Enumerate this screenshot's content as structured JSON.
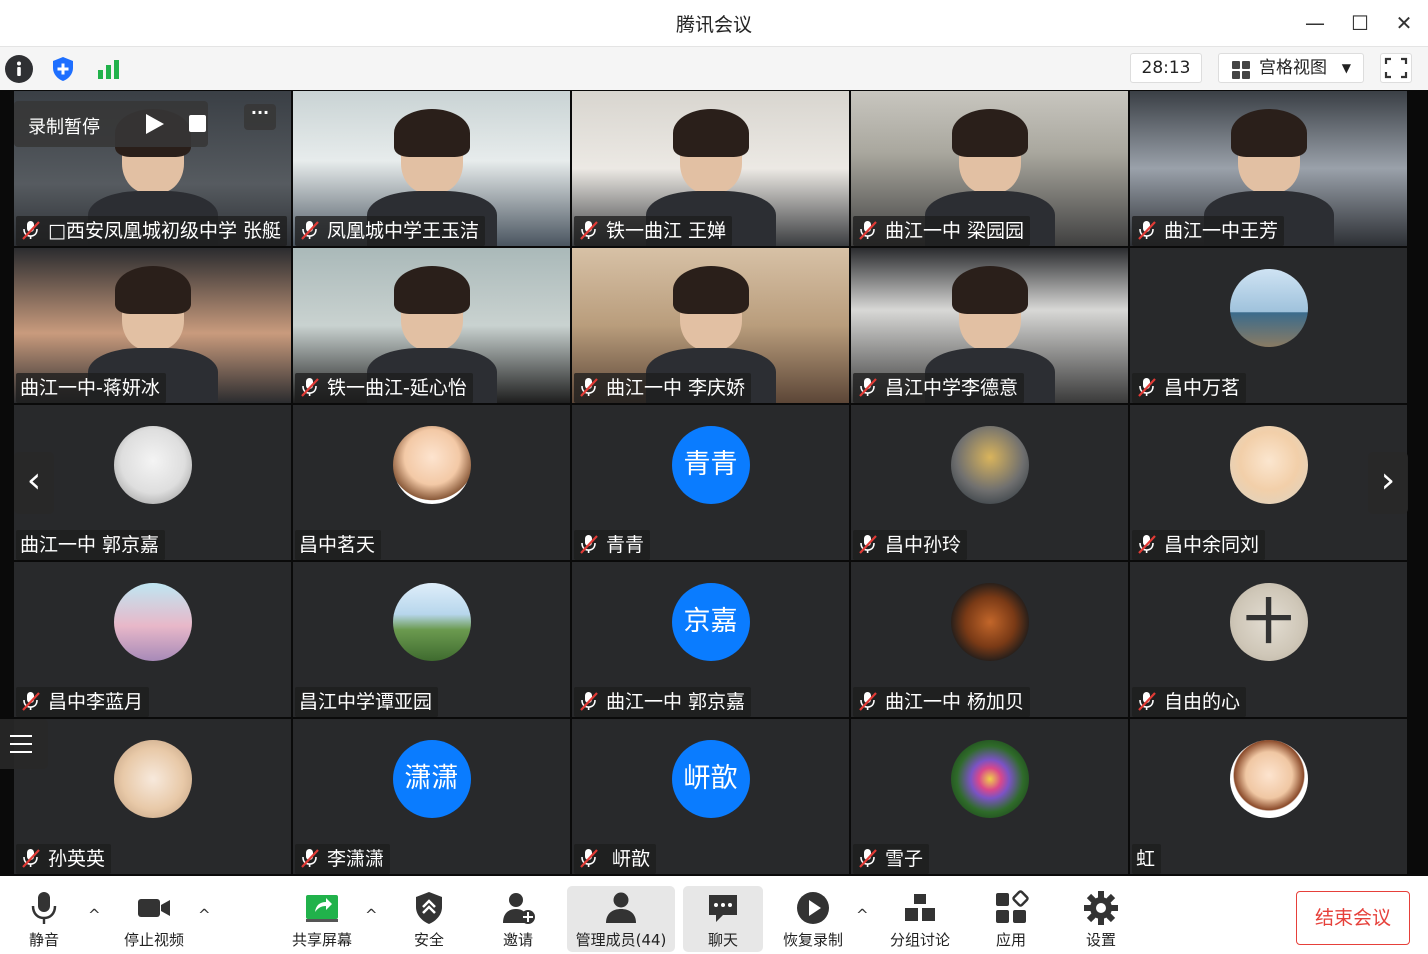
{
  "window": {
    "title": "腾讯会议",
    "minimize": "—",
    "maximize": "☐",
    "close": "✕"
  },
  "top_bar": {
    "timer": "28:13",
    "view_label": "宫格视图",
    "view_caret": "▼"
  },
  "recording": {
    "label": "录制暂停",
    "more": "···"
  },
  "nav": {
    "prev": "‹",
    "next": "›"
  },
  "participants": [
    {
      "name": "□西安凤凰城初级中学 张艇",
      "muted": true,
      "type": "video"
    },
    {
      "name": "凤凰城中学王玉洁",
      "muted": true,
      "type": "video"
    },
    {
      "name": "铁一曲江 王婵",
      "muted": true,
      "type": "video"
    },
    {
      "name": "曲江一中 梁园园",
      "muted": true,
      "type": "video"
    },
    {
      "name": "曲江一中王芳",
      "muted": true,
      "type": "video"
    },
    {
      "name": "曲江一中-蒋妍冰",
      "muted": false,
      "type": "video"
    },
    {
      "name": "铁一曲江-延心怡",
      "muted": true,
      "type": "video"
    },
    {
      "name": "曲江一中 李庆娇",
      "muted": true,
      "type": "video"
    },
    {
      "name": "昌江中学李德意",
      "muted": true,
      "type": "video"
    },
    {
      "name": "昌中万茗",
      "muted": true,
      "type": "avatar",
      "icon": "seaside-photo-avatar-icon"
    },
    {
      "name": "曲江一中 郭京嘉",
      "muted": false,
      "type": "avatar",
      "icon": "snow-bear-avatar-icon"
    },
    {
      "name": "昌中茗天",
      "muted": false,
      "type": "avatar",
      "icon": "cartoon-girl-avatar-icon"
    },
    {
      "name": "青青",
      "muted": true,
      "type": "text",
      "avatar_text": "青青"
    },
    {
      "name": "昌中孙玲",
      "muted": true,
      "type": "avatar",
      "icon": "umbrella-avatar-icon"
    },
    {
      "name": "昌中余同刘",
      "muted": true,
      "type": "avatar",
      "icon": "baby-avatar-icon"
    },
    {
      "name": "昌中李蓝月",
      "muted": true,
      "type": "avatar",
      "icon": "anime-girl-avatar-icon"
    },
    {
      "name": "昌江中学谭亚园",
      "muted": false,
      "type": "avatar",
      "icon": "wedding-avatar-icon"
    },
    {
      "name": "曲江一中 郭京嘉",
      "muted": true,
      "type": "text",
      "avatar_text": "京嘉"
    },
    {
      "name": "曲江一中 杨加贝",
      "muted": true,
      "type": "avatar",
      "icon": "food-pan-avatar-icon"
    },
    {
      "name": "自由的心",
      "muted": true,
      "type": "avatar",
      "icon": "character-ten-avatar-icon"
    },
    {
      "name": "孙英英",
      "muted": true,
      "type": "avatar",
      "icon": "cat-bunny-avatar-icon"
    },
    {
      "name": "李潇潇",
      "muted": true,
      "type": "text",
      "avatar_text": "潇潇"
    },
    {
      "name": "  岍歆",
      "muted": true,
      "type": "text",
      "avatar_text": "岍歆"
    },
    {
      "name": "雪子",
      "muted": true,
      "type": "avatar",
      "icon": "pinwheel-avatar-icon"
    },
    {
      "name": "虹",
      "muted": false,
      "type": "avatar",
      "icon": "cartoon-kid-avatar-icon"
    },
    {
      "avatar_char": "十"
    }
  ],
  "bottom_bar": {
    "mute": "静音",
    "stop_video": "停止视频",
    "share": "共享屏幕",
    "security": "安全",
    "invite": "邀请",
    "members": "管理成员(44)",
    "chat": "聊天",
    "resume_record": "恢复录制",
    "breakout": "分组讨论",
    "apps": "应用",
    "settings": "设置",
    "end": "结束会议",
    "chevron": "^"
  },
  "colors": {
    "accent": "#0a7cff",
    "end": "#e6403a",
    "tile_bg": "#28292b",
    "stage_bg": "#0a0a0a"
  }
}
